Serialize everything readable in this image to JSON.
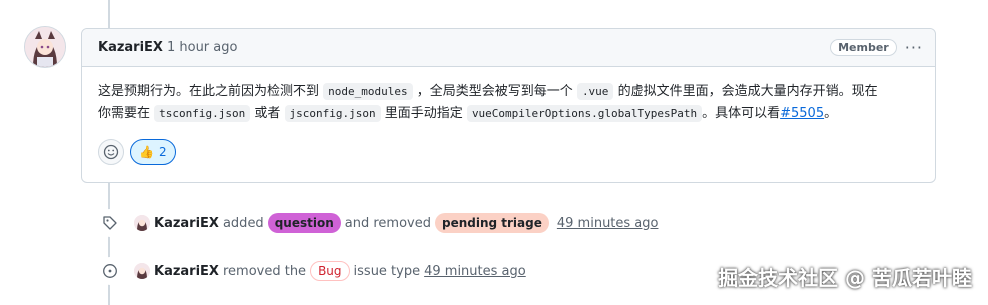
{
  "comment": {
    "author": "KazariEX",
    "time": "1 hour ago",
    "role": "Member",
    "more": "···",
    "body": {
      "t1": "这是预期行为。在此之前因为检测不到",
      "c1": "node_modules",
      "t2": "，全局类型会被写到每一个",
      "c2": ".vue",
      "t3": "的虚拟文件里面，会造成大量内存开销。现在",
      "t4": "你需要在",
      "c3": "tsconfig.json",
      "t5": "或者",
      "c4": "jsconfig.json",
      "t6": "里面手动指定",
      "c5": "vueCompilerOptions.globalTypesPath",
      "t7": "。具体可以看",
      "link": "#5505",
      "t8": "。"
    },
    "reactions": {
      "thumbs": "👍",
      "count": "2"
    }
  },
  "events": [
    {
      "author": "KazariEX",
      "verb1": "added",
      "label1": "question",
      "label1_color": "#cf62d6",
      "verb2": "and removed",
      "label2": "pending triage",
      "label2_color": "#fbd1c5",
      "time": "49 minutes ago"
    },
    {
      "author": "KazariEX",
      "verb1": "removed the",
      "type": "Bug",
      "verb2": "issue type",
      "time": "49 minutes ago"
    }
  ],
  "watermark": "掘金技术社区 @ 苦瓜若叶睦",
  "colors": {
    "accent": "#0969da",
    "border": "#d1d9e0"
  }
}
